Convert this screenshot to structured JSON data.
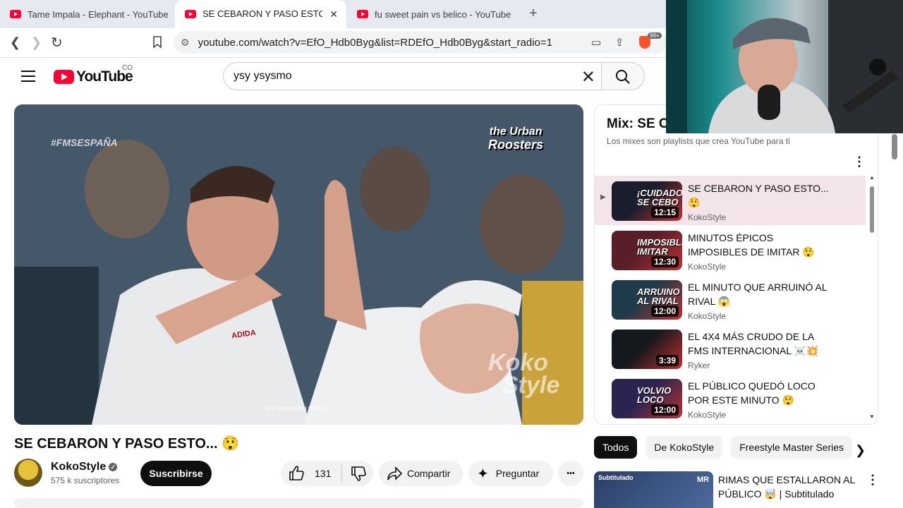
{
  "browser": {
    "tabs": [
      {
        "label": "Tame Impala - Elephant - YouTube",
        "active": false
      },
      {
        "label": "SE CEBARON Y PASO ESTO... 😲",
        "active": true
      },
      {
        "label": "fu sweet pain vs belico - YouTube",
        "active": false
      }
    ],
    "new_tab_label": "+",
    "url": "youtube.com/watch?v=EfO_Hdb0Byg&list=RDEfO_Hdb0Byg&start_radio=1",
    "extension_badge": "99+"
  },
  "header": {
    "logo_text": "YouTube",
    "region": "CO",
    "search_value": "ysy ysysmo"
  },
  "video": {
    "overlay_tag": "#FMSESPAÑA",
    "overlay_brand_line1": "the Urban",
    "overlay_brand_line2": "Roosters",
    "watermark_line1": "Koko",
    "watermark_line2": "Style",
    "bottom_text": "ENTRADAS EN FMS.TV",
    "shirt_text": "ADIDA",
    "title": "SE CEBARON Y PASO ESTO... 😲",
    "channel": "KokoStyle",
    "subscribers": "575 k suscriptores",
    "subscribe_label": "Suscribirse",
    "likes": "131",
    "share_label": "Compartir",
    "ask_label": "Preguntar",
    "more_label": "•••"
  },
  "mix": {
    "title": "Mix: SE C",
    "subtitle": "Los mixes son playlists que crea YouTube para ti",
    "items": [
      {
        "title": "SE CEBARON Y PASO ESTO... 😲",
        "channel": "KokoStyle",
        "duration": "12:15",
        "thumb_text": "¡CUIDADO! SE CEBO",
        "thumb_color": "#1a1d2e",
        "selected": true,
        "marker": "▶"
      },
      {
        "title": "MINUTOS ÉPICOS IMPOSIBLES DE IMITAR 😲",
        "channel": "KokoStyle",
        "duration": "12:30",
        "thumb_text": "IMPOSIBLE IMITAR",
        "thumb_color": "#5a1e28",
        "selected": false,
        "marker": ""
      },
      {
        "title": "EL MINUTO QUE ARRUINÓ AL RIVAL 😱",
        "channel": "KokoStyle",
        "duration": "12:00",
        "thumb_text": "ARRUINO AL RIVAL",
        "thumb_color": "#1f3b4a",
        "selected": false,
        "marker": ""
      },
      {
        "title": "EL 4X4 MÁS CRUDO DE LA FMS INTERNACIONAL ☠️💥",
        "channel": "Ryker",
        "duration": "3:39",
        "thumb_text": "",
        "thumb_color": "#15181c",
        "selected": false,
        "marker": ""
      },
      {
        "title": "EL PÚBLICO QUEDÓ LOCO POR ESTE MINUTO 😲",
        "channel": "KokoStyle",
        "duration": "12:00",
        "thumb_text": "VOLVIO LOCO",
        "thumb_color": "#2b2450",
        "selected": false,
        "marker": ""
      }
    ]
  },
  "chips": [
    "Todos",
    "De KokoStyle",
    "Freestyle Master Series"
  ],
  "recommendation": {
    "title": "RIMAS QUE ESTALLARON AL PÚBLICO 🤯 | Subtitulado",
    "thumb_label": "Subtitulado",
    "thumb_brand": "MR"
  },
  "colors": {
    "brand_red": "#ff0033",
    "selected_row": "#f2e4e8",
    "chip_active": "#0f0f0f"
  }
}
